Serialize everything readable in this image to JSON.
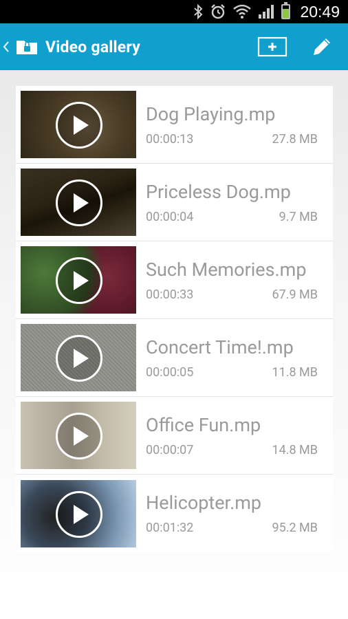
{
  "status_bar": {
    "time": "20:49",
    "icons": [
      "bluetooth-icon",
      "alarm-icon",
      "wifi-icon",
      "signal-icon",
      "battery-icon"
    ]
  },
  "action_bar": {
    "title": "Video gallery",
    "back_icon": "chevron-left-icon",
    "app_icon": "folder-lock-icon",
    "actions": [
      "add-icon",
      "edit-pencil-icon"
    ],
    "color": "#119fcd"
  },
  "videos": [
    {
      "name": "Dog Playing.mp",
      "duration": "00:00:13",
      "size": "27.8  MB",
      "thumb": "dog playing"
    },
    {
      "name": "Priceless Dog.mp",
      "duration": "00:00:04",
      "size": "9.7  MB",
      "thumb": "dog dark"
    },
    {
      "name": "Such Memories.mp",
      "duration": "00:00:33",
      "size": "67.9  MB",
      "thumb": "garden"
    },
    {
      "name": "Concert Time!.mp",
      "duration": "00:00:05",
      "size": "11.8  MB",
      "thumb": "static"
    },
    {
      "name": "Office Fun.mp",
      "duration": "00:00:07",
      "size": "14.8  MB",
      "thumb": "office"
    },
    {
      "name": "Helicopter.mp",
      "duration": "00:01:32",
      "size": "95.2  MB",
      "thumb": "helicopter"
    }
  ]
}
